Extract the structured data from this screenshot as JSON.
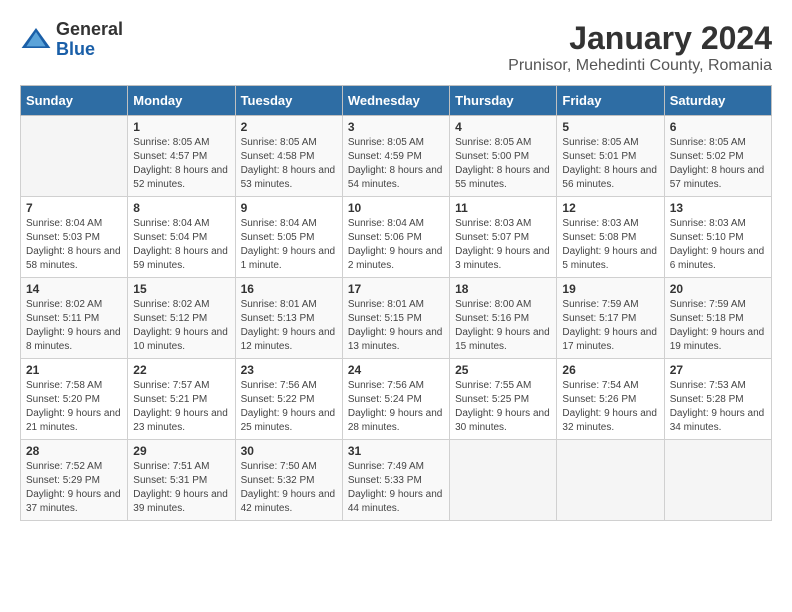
{
  "logo": {
    "general": "General",
    "blue": "Blue"
  },
  "title": "January 2024",
  "subtitle": "Prunisor, Mehedinti County, Romania",
  "weekdays": [
    "Sunday",
    "Monday",
    "Tuesday",
    "Wednesday",
    "Thursday",
    "Friday",
    "Saturday"
  ],
  "weeks": [
    [
      {
        "day": "",
        "sunrise": "",
        "sunset": "",
        "daylight": ""
      },
      {
        "day": "1",
        "sunrise": "Sunrise: 8:05 AM",
        "sunset": "Sunset: 4:57 PM",
        "daylight": "Daylight: 8 hours and 52 minutes."
      },
      {
        "day": "2",
        "sunrise": "Sunrise: 8:05 AM",
        "sunset": "Sunset: 4:58 PM",
        "daylight": "Daylight: 8 hours and 53 minutes."
      },
      {
        "day": "3",
        "sunrise": "Sunrise: 8:05 AM",
        "sunset": "Sunset: 4:59 PM",
        "daylight": "Daylight: 8 hours and 54 minutes."
      },
      {
        "day": "4",
        "sunrise": "Sunrise: 8:05 AM",
        "sunset": "Sunset: 5:00 PM",
        "daylight": "Daylight: 8 hours and 55 minutes."
      },
      {
        "day": "5",
        "sunrise": "Sunrise: 8:05 AM",
        "sunset": "Sunset: 5:01 PM",
        "daylight": "Daylight: 8 hours and 56 minutes."
      },
      {
        "day": "6",
        "sunrise": "Sunrise: 8:05 AM",
        "sunset": "Sunset: 5:02 PM",
        "daylight": "Daylight: 8 hours and 57 minutes."
      }
    ],
    [
      {
        "day": "7",
        "sunrise": "Sunrise: 8:04 AM",
        "sunset": "Sunset: 5:03 PM",
        "daylight": "Daylight: 8 hours and 58 minutes."
      },
      {
        "day": "8",
        "sunrise": "Sunrise: 8:04 AM",
        "sunset": "Sunset: 5:04 PM",
        "daylight": "Daylight: 8 hours and 59 minutes."
      },
      {
        "day": "9",
        "sunrise": "Sunrise: 8:04 AM",
        "sunset": "Sunset: 5:05 PM",
        "daylight": "Daylight: 9 hours and 1 minute."
      },
      {
        "day": "10",
        "sunrise": "Sunrise: 8:04 AM",
        "sunset": "Sunset: 5:06 PM",
        "daylight": "Daylight: 9 hours and 2 minutes."
      },
      {
        "day": "11",
        "sunrise": "Sunrise: 8:03 AM",
        "sunset": "Sunset: 5:07 PM",
        "daylight": "Daylight: 9 hours and 3 minutes."
      },
      {
        "day": "12",
        "sunrise": "Sunrise: 8:03 AM",
        "sunset": "Sunset: 5:08 PM",
        "daylight": "Daylight: 9 hours and 5 minutes."
      },
      {
        "day": "13",
        "sunrise": "Sunrise: 8:03 AM",
        "sunset": "Sunset: 5:10 PM",
        "daylight": "Daylight: 9 hours and 6 minutes."
      }
    ],
    [
      {
        "day": "14",
        "sunrise": "Sunrise: 8:02 AM",
        "sunset": "Sunset: 5:11 PM",
        "daylight": "Daylight: 9 hours and 8 minutes."
      },
      {
        "day": "15",
        "sunrise": "Sunrise: 8:02 AM",
        "sunset": "Sunset: 5:12 PM",
        "daylight": "Daylight: 9 hours and 10 minutes."
      },
      {
        "day": "16",
        "sunrise": "Sunrise: 8:01 AM",
        "sunset": "Sunset: 5:13 PM",
        "daylight": "Daylight: 9 hours and 12 minutes."
      },
      {
        "day": "17",
        "sunrise": "Sunrise: 8:01 AM",
        "sunset": "Sunset: 5:15 PM",
        "daylight": "Daylight: 9 hours and 13 minutes."
      },
      {
        "day": "18",
        "sunrise": "Sunrise: 8:00 AM",
        "sunset": "Sunset: 5:16 PM",
        "daylight": "Daylight: 9 hours and 15 minutes."
      },
      {
        "day": "19",
        "sunrise": "Sunrise: 7:59 AM",
        "sunset": "Sunset: 5:17 PM",
        "daylight": "Daylight: 9 hours and 17 minutes."
      },
      {
        "day": "20",
        "sunrise": "Sunrise: 7:59 AM",
        "sunset": "Sunset: 5:18 PM",
        "daylight": "Daylight: 9 hours and 19 minutes."
      }
    ],
    [
      {
        "day": "21",
        "sunrise": "Sunrise: 7:58 AM",
        "sunset": "Sunset: 5:20 PM",
        "daylight": "Daylight: 9 hours and 21 minutes."
      },
      {
        "day": "22",
        "sunrise": "Sunrise: 7:57 AM",
        "sunset": "Sunset: 5:21 PM",
        "daylight": "Daylight: 9 hours and 23 minutes."
      },
      {
        "day": "23",
        "sunrise": "Sunrise: 7:56 AM",
        "sunset": "Sunset: 5:22 PM",
        "daylight": "Daylight: 9 hours and 25 minutes."
      },
      {
        "day": "24",
        "sunrise": "Sunrise: 7:56 AM",
        "sunset": "Sunset: 5:24 PM",
        "daylight": "Daylight: 9 hours and 28 minutes."
      },
      {
        "day": "25",
        "sunrise": "Sunrise: 7:55 AM",
        "sunset": "Sunset: 5:25 PM",
        "daylight": "Daylight: 9 hours and 30 minutes."
      },
      {
        "day": "26",
        "sunrise": "Sunrise: 7:54 AM",
        "sunset": "Sunset: 5:26 PM",
        "daylight": "Daylight: 9 hours and 32 minutes."
      },
      {
        "day": "27",
        "sunrise": "Sunrise: 7:53 AM",
        "sunset": "Sunset: 5:28 PM",
        "daylight": "Daylight: 9 hours and 34 minutes."
      }
    ],
    [
      {
        "day": "28",
        "sunrise": "Sunrise: 7:52 AM",
        "sunset": "Sunset: 5:29 PM",
        "daylight": "Daylight: 9 hours and 37 minutes."
      },
      {
        "day": "29",
        "sunrise": "Sunrise: 7:51 AM",
        "sunset": "Sunset: 5:31 PM",
        "daylight": "Daylight: 9 hours and 39 minutes."
      },
      {
        "day": "30",
        "sunrise": "Sunrise: 7:50 AM",
        "sunset": "Sunset: 5:32 PM",
        "daylight": "Daylight: 9 hours and 42 minutes."
      },
      {
        "day": "31",
        "sunrise": "Sunrise: 7:49 AM",
        "sunset": "Sunset: 5:33 PM",
        "daylight": "Daylight: 9 hours and 44 minutes."
      },
      {
        "day": "",
        "sunrise": "",
        "sunset": "",
        "daylight": ""
      },
      {
        "day": "",
        "sunrise": "",
        "sunset": "",
        "daylight": ""
      },
      {
        "day": "",
        "sunrise": "",
        "sunset": "",
        "daylight": ""
      }
    ]
  ]
}
